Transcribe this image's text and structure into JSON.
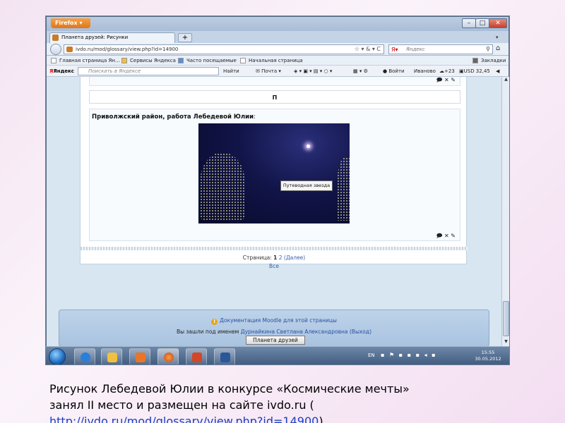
{
  "browser": {
    "app_button": "Firefox",
    "tab_title": "Планета друзей: Рисунки",
    "url": "ivdo.ru/mod/glossary/view.php?id=14900",
    "search_placeholder": "Яндекс",
    "bookmarks": [
      "Главная страница Ян...",
      "Сервисы Яндекса",
      "Часто посещаемые",
      "Начальная страница"
    ],
    "bookmarks_right": "Закладки",
    "yandex_bar": {
      "logo": "Яндекс",
      "search_placeholder": "Поискать в Яндексе",
      "find_label": "Найти",
      "mail_label": "Почта",
      "login_label": "Войти",
      "city": "Иваново",
      "weather": "+23",
      "currency": "USD 32,45"
    }
  },
  "page": {
    "letter": "П",
    "entry_title": "Приволжский район, работа Лебедевой Юлии",
    "entry_title_suffix": ":",
    "image_tooltip": "Путеводная звезда",
    "pager": {
      "label": "Страница:",
      "current": "1",
      "next_page": "2",
      "next_label": "(Далее)",
      "all_label": "Все"
    },
    "footer": {
      "doc_link": "Документация Moodle для этой страницы",
      "login_prefix": "Вы зашли под именем",
      "user_name": "Дурнайкина Светлана Александровна",
      "logout": "(Выход)",
      "home_button": "Планета друзей"
    }
  },
  "taskbar": {
    "lang": "EN",
    "time": "15:55",
    "date": "30.05.2012"
  },
  "caption": {
    "line1": "Рисунок Лебедевой Юлии в конкурсе «Космические мечты»",
    "line2": "занял II место и размещен на сайте ivdo.ru (",
    "link": "http://ivdo.ru/mod/glossary/view.php?id=14900",
    "after": ")"
  }
}
